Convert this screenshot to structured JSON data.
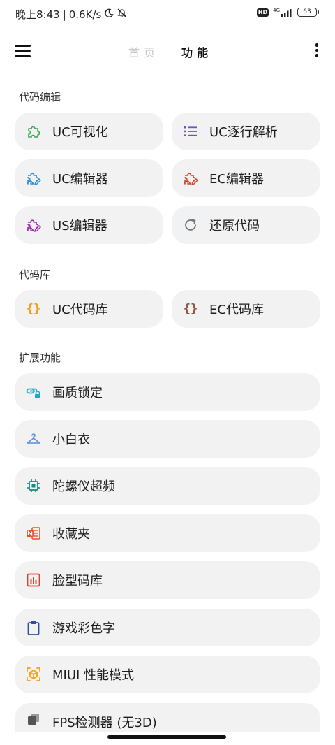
{
  "status": {
    "time": "晚上8:43",
    "speed": "0.6K/s",
    "hd": "HD",
    "network": "4G",
    "battery": "63"
  },
  "header": {
    "tab_home": "首页",
    "tab_function": "功能"
  },
  "sections": {
    "code_edit": "代码编辑",
    "code_lib": "代码库",
    "extensions": "扩展功能"
  },
  "code_edit": {
    "uc_visual": "UC可视化",
    "uc_line_parse": "UC逐行解析",
    "uc_editor": "UC编辑器",
    "ec_editor": "EC编辑器",
    "us_editor": "US编辑器",
    "restore_code": "还原代码"
  },
  "code_lib": {
    "uc_lib": "UC代码库",
    "ec_lib": "EC代码库"
  },
  "extensions": {
    "quality_lock": "画质锁定",
    "small_white": "小白衣",
    "gyro_overclock": "陀螺仪超频",
    "favorites": "收藏夹",
    "face_code_lib": "脸型码库",
    "game_color_text": "游戏彩色字",
    "miui_perf_mode": "MIUI 性能模式",
    "fps_detector": "FPS检测器 (无3D)"
  },
  "colors": {
    "green": "#3aa655",
    "purple": "#6f52c9",
    "blue": "#2e8fd6",
    "red": "#d9432f",
    "violet": "#9c2db0",
    "gray": "#6d7780",
    "orange": "#f0a020",
    "brown": "#8a5a44",
    "teal": "#1fa8c9",
    "lightblue": "#5b8fd9",
    "darkteal": "#148a7a",
    "orangered": "#e8542a",
    "navy": "#2f4fa2",
    "amber": "#f2a21a",
    "darkgray": "#555555"
  }
}
